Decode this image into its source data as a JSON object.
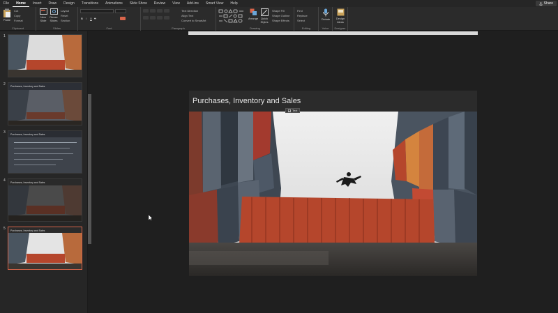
{
  "tabs": [
    "File",
    "Home",
    "Insert",
    "Draw",
    "Design",
    "Transitions",
    "Animations",
    "Slide Show",
    "Review",
    "View",
    "Add-ins",
    "Smart View",
    "Help"
  ],
  "active_tab": "Home",
  "share_label": "Share",
  "ribbon": {
    "paste_label": "Paste",
    "cut_label": "Cut",
    "copy_label": "Copy",
    "format_label": "Format",
    "new_slide_label": "New Slide",
    "reuse_slides_label": "Reuse Slides",
    "layout_label": "Layout",
    "reset_label": "Reset",
    "section_label": "Section",
    "text_direction_label": "Text Direction",
    "align_text_label": "Align Text",
    "convert_label": "Convert to SmartArt",
    "arrange_label": "Arrange",
    "quick_styles_label": "Quick Styles",
    "shape_fill_label": "Shape Fill",
    "shape_outline_label": "Shape Outline",
    "shape_effects_label": "Shape Effects",
    "find_label": "Find",
    "replace_label": "Replace",
    "select_label": "Select",
    "dictate_label": "Dictate",
    "design_ideas_label": "Design Ideas",
    "groups": {
      "clipboard": "Clipboard",
      "slides": "Slides",
      "font": "Font",
      "paragraph": "Paragraph",
      "drawing": "Drawing",
      "editing": "Editing",
      "voice": "Voice",
      "designer": "Designer"
    }
  },
  "thumbnails": [
    {
      "num": "1",
      "title": ""
    },
    {
      "num": "2",
      "title": "Purchases, Inventory and Sales"
    },
    {
      "num": "3",
      "title": "Purchases, Inventory and Sales"
    },
    {
      "num": "4",
      "title": "Purchases, Inventory and Sales"
    },
    {
      "num": "5",
      "title": "Purchases, Inventory and Sales"
    }
  ],
  "selected_slide": 5,
  "slide": {
    "title": "Purchases, Inventory and Sales",
    "alt_badge": "Text"
  },
  "colors": {
    "accent": "#d9654b",
    "container_red": "#b5462c"
  }
}
